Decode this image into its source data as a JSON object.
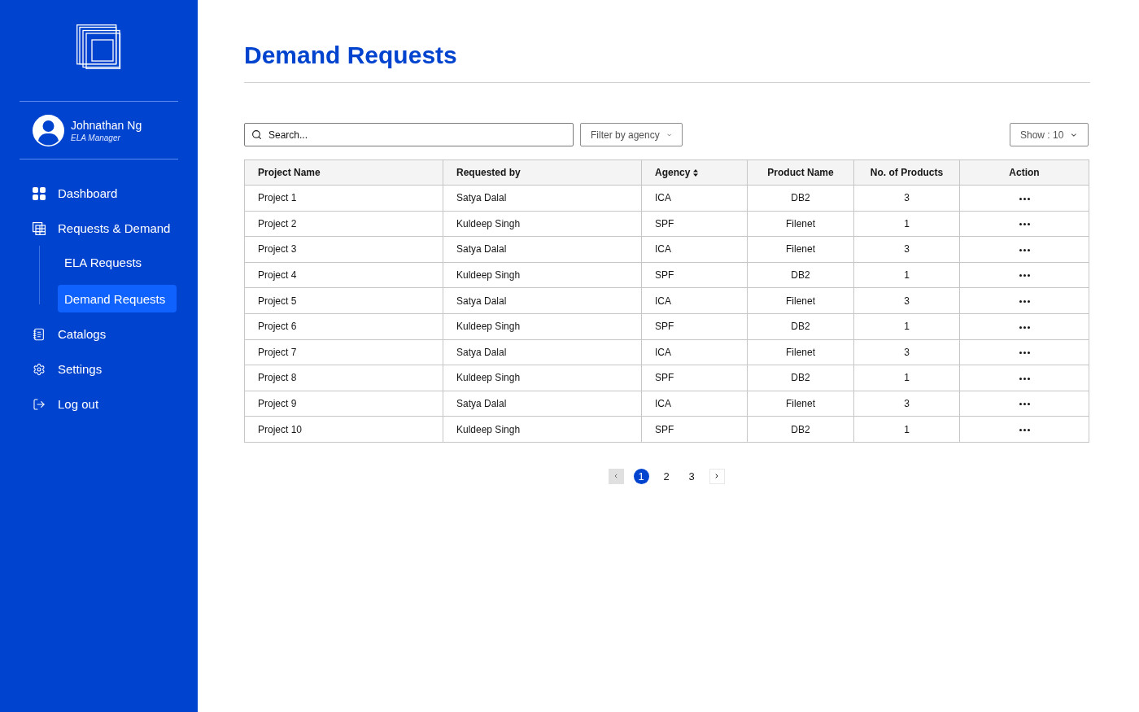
{
  "sidebar": {
    "user": {
      "name": "Johnathan Ng",
      "role": "ELA Manager"
    },
    "nav": [
      {
        "label": "Dashboard",
        "selected": false
      },
      {
        "label": "Requests & Demand",
        "selected": false,
        "children": [
          {
            "label": "ELA Requests",
            "selected": false
          },
          {
            "label": "Demand Requests",
            "selected": true
          }
        ]
      },
      {
        "label": "Catalogs",
        "selected": false
      },
      {
        "label": "Settings",
        "selected": false
      },
      {
        "label": "Log out",
        "selected": false
      }
    ]
  },
  "page": {
    "title": "Demand Requests"
  },
  "toolbar": {
    "search": {
      "placeholder": "Search..."
    },
    "filter": {
      "label": "Filter by agency"
    },
    "page_size": {
      "label": "Show : 10"
    }
  },
  "table": {
    "columns": [
      {
        "label": "Project Name",
        "sortable": false
      },
      {
        "label": "Requested by",
        "sortable": false
      },
      {
        "label": "Agency",
        "sortable": true
      },
      {
        "label": "Product Name",
        "sortable": false
      },
      {
        "label": "No. of Products",
        "sortable": false
      },
      {
        "label": "Action",
        "sortable": false
      }
    ],
    "rows": [
      {
        "cells": [
          "Project 1",
          "Satya Dalal",
          "ICA",
          "DB2",
          "3"
        ]
      },
      {
        "cells": [
          "Project 2",
          "Kuldeep Singh",
          "SPF",
          "Filenet",
          "1"
        ]
      },
      {
        "cells": [
          "Project 3",
          "Satya Dalal",
          "ICA",
          "Filenet",
          "3"
        ]
      },
      {
        "cells": [
          "Project 4",
          "Kuldeep Singh",
          "SPF",
          "DB2",
          "1"
        ]
      },
      {
        "cells": [
          "Project 5",
          "Satya Dalal",
          "ICA",
          "Filenet",
          "3"
        ]
      },
      {
        "cells": [
          "Project 6",
          "Kuldeep Singh",
          "SPF",
          "DB2",
          "1"
        ]
      },
      {
        "cells": [
          "Project 7",
          "Satya Dalal",
          "ICA",
          "Filenet",
          "3"
        ]
      },
      {
        "cells": [
          "Project 8",
          "Kuldeep Singh",
          "SPF",
          "DB2",
          "1"
        ]
      },
      {
        "cells": [
          "Project 9",
          "Satya Dalal",
          "ICA",
          "Filenet",
          "3"
        ]
      },
      {
        "cells": [
          "Project 10",
          "Kuldeep Singh",
          "SPF",
          "DB2",
          "1"
        ]
      }
    ]
  },
  "pagination": {
    "previous": {
      "disabled": true
    },
    "pages": [
      {
        "label": "1",
        "selected": true
      },
      {
        "label": "2",
        "selected": false
      },
      {
        "label": "3",
        "selected": false
      }
    ],
    "next": {
      "disabled": false
    }
  }
}
